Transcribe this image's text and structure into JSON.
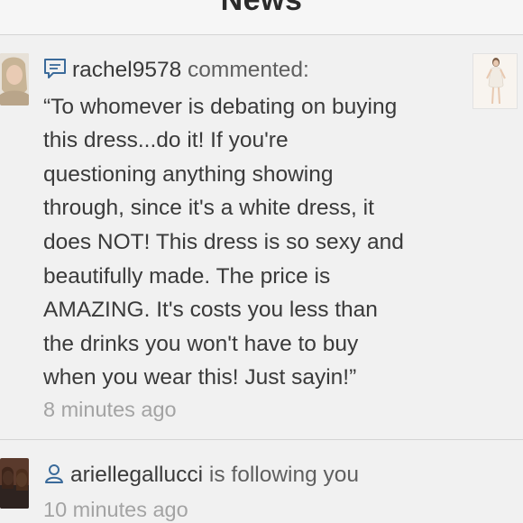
{
  "header": {
    "title": "News"
  },
  "items": [
    {
      "type": "comment",
      "icon": "comment-icon",
      "username": "rachel9578",
      "action": "commented:",
      "comment_lines": [
        "“To whomever is debating on buying",
        "this dress...do it! If you're",
        "questioning anything showing",
        "through, since it's a white dress, it",
        "does NOT! This dress is so sexy and",
        "beautifully made. The price is",
        "AMAZING. It's costs you less than",
        "the drinks you won't have to buy",
        "when you wear this! Just sayin!”"
      ],
      "time": "8 minutes ago"
    },
    {
      "type": "follow",
      "icon": "user-icon",
      "username": "ariellegallucci",
      "action": "is following you",
      "time": "10 minutes ago"
    }
  ],
  "colors": {
    "background": "#f1f1f1",
    "text": "#3a3a3a",
    "secondary_text": "#a3a3a3",
    "divider": "#d4d4d4"
  }
}
